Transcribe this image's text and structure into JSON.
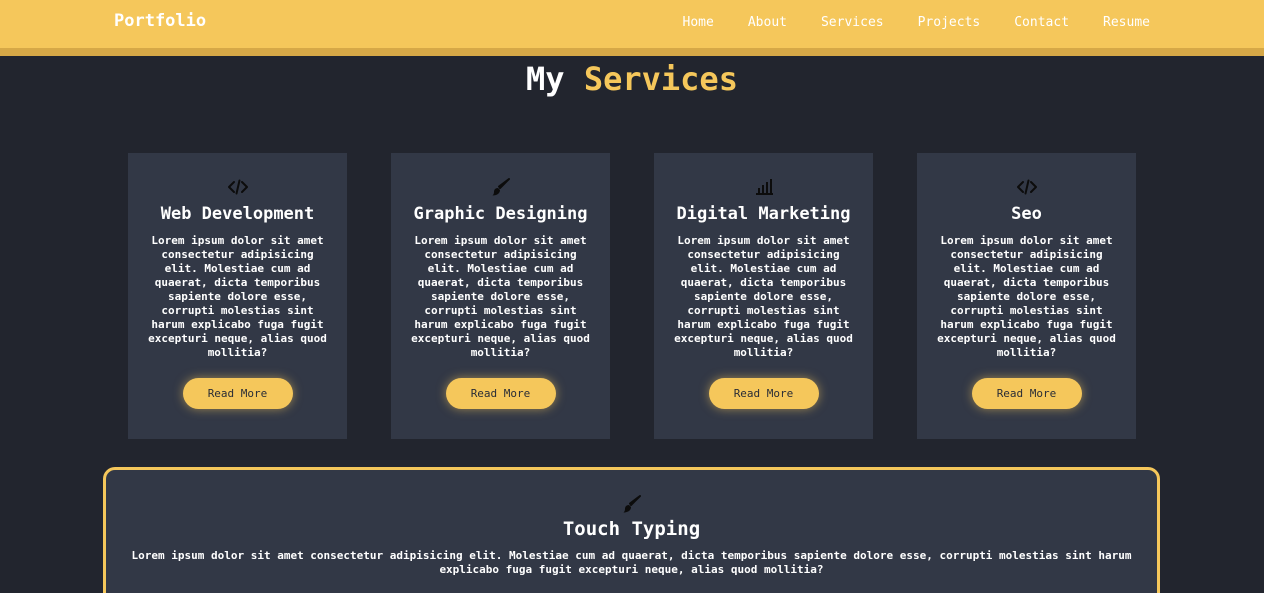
{
  "nav": {
    "brand": "Portfolio",
    "links": [
      "Home",
      "About",
      "Services",
      "Projects",
      "Contact",
      "Resume"
    ]
  },
  "section": {
    "title_plain": "My",
    "title_accent": "Services"
  },
  "services": [
    {
      "icon": "code-icon",
      "title": "Web Development",
      "text": "Lorem ipsum dolor sit amet consectetur adipisicing elit. Molestiae cum ad quaerat, dicta temporibus sapiente dolore esse, corrupti molestias sint harum explicabo fuga fugit excepturi neque, alias quod mollitia?",
      "button": "Read More"
    },
    {
      "icon": "paintbrush-icon",
      "title": "Graphic Designing",
      "text": "Lorem ipsum dolor sit amet consectetur adipisicing elit. Molestiae cum ad quaerat, dicta temporibus sapiente dolore esse, corrupti molestias sint harum explicabo fuga fugit excepturi neque, alias quod mollitia?",
      "button": "Read More"
    },
    {
      "icon": "chart-bars-icon",
      "title": "Digital Marketing",
      "text": "Lorem ipsum dolor sit amet consectetur adipisicing elit. Molestiae cum ad quaerat, dicta temporibus sapiente dolore esse, corrupti molestias sint harum explicabo fuga fugit excepturi neque, alias quod mollitia?",
      "button": "Read More"
    },
    {
      "icon": "code-icon",
      "title": "Seo",
      "text": "Lorem ipsum dolor sit amet consectetur adipisicing elit. Molestiae cum ad quaerat, dicta temporibus sapiente dolore esse, corrupti molestias sint harum explicabo fuga fugit excepturi neque, alias quod mollitia?",
      "button": "Read More"
    }
  ],
  "featured": {
    "icon": "paintbrush-icon",
    "title": "Touch Typing",
    "text": "Lorem ipsum dolor sit amet consectetur adipisicing elit. Molestiae cum ad quaerat, dicta temporibus sapiente dolore esse, corrupti molestias sint harum explicabo fuga fugit excepturi neque, alias quod mollitia?"
  },
  "colors": {
    "accent": "#f5c75b",
    "background": "#22252e",
    "card": "#323846"
  }
}
